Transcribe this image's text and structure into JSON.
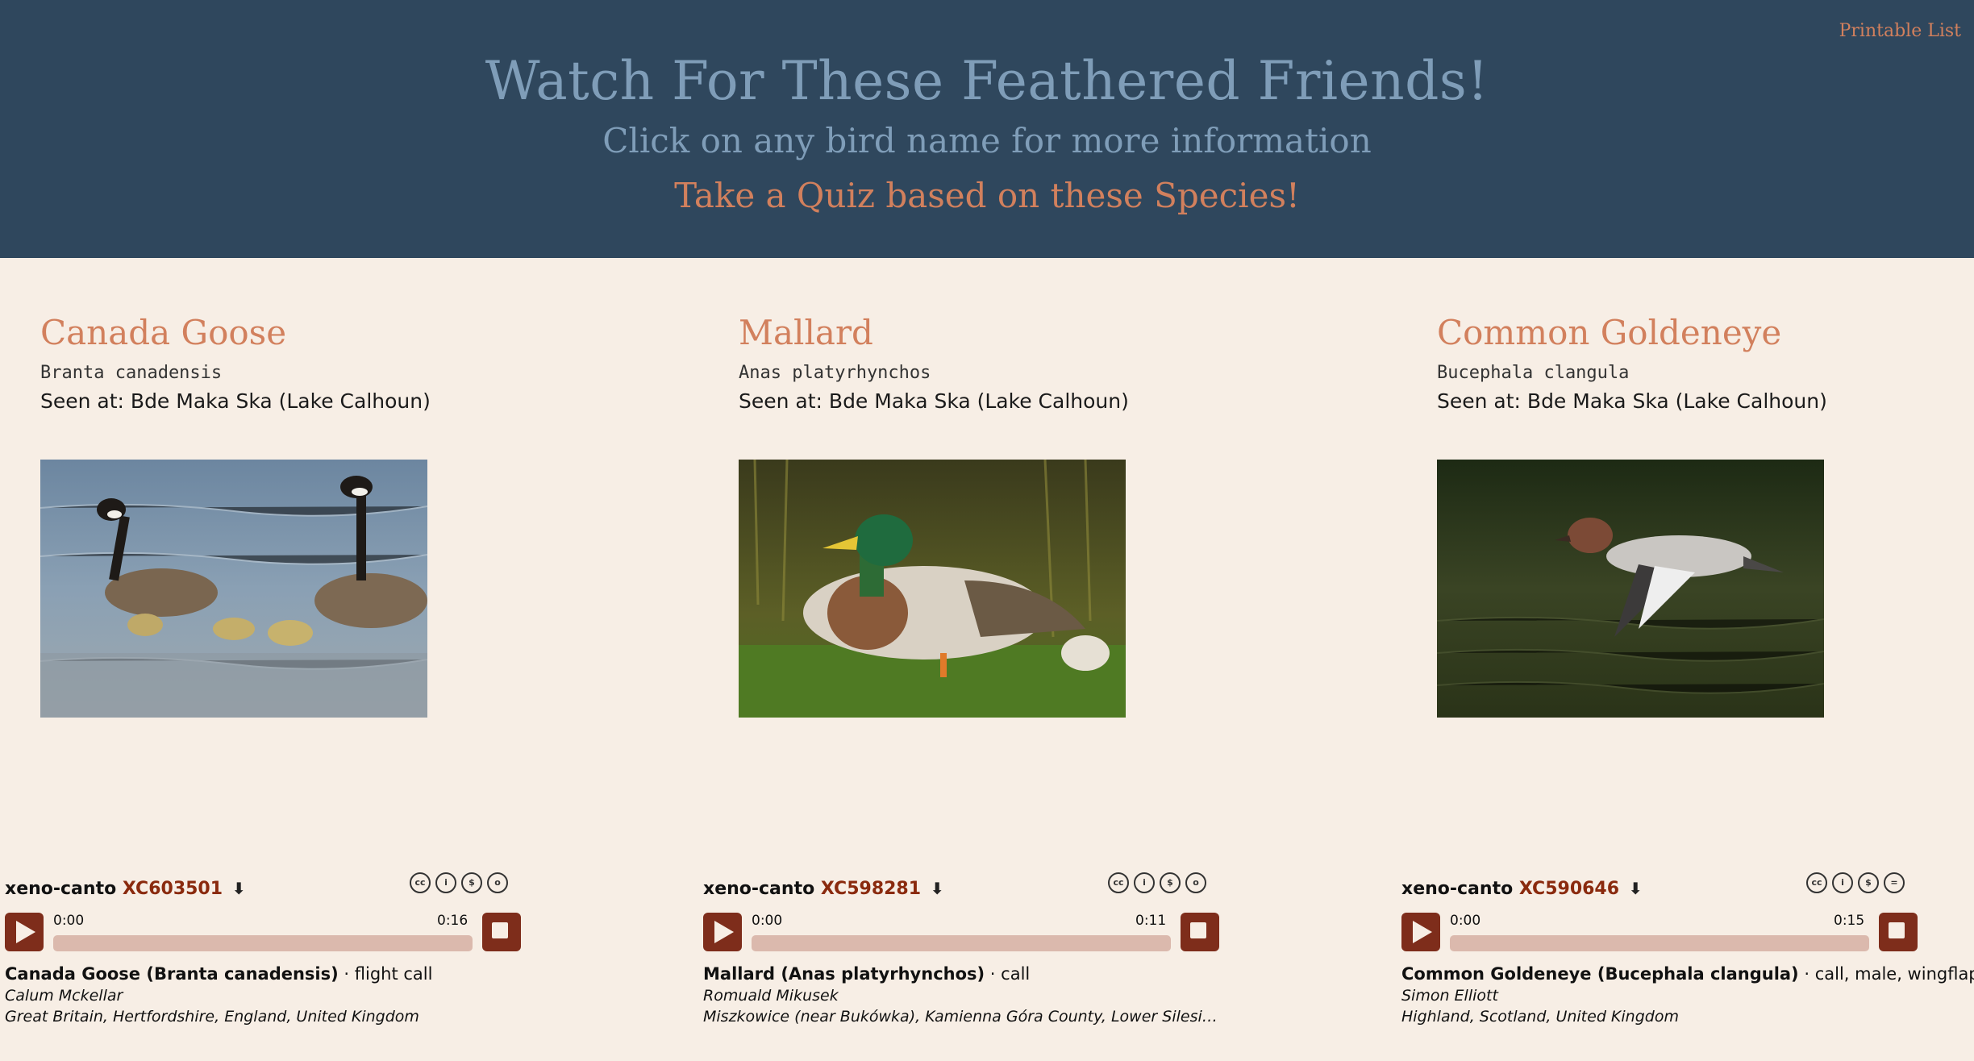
{
  "header": {
    "printable_link": "Printable List",
    "title": "Watch For These Feathered Friends!",
    "subtitle": "Click on any bird name for more information",
    "quiz_link": "Take a Quiz based on these Species!"
  },
  "birds": [
    {
      "name": "Canada Goose",
      "scientific": "Branta canadensis",
      "seen_at": "Seen at: Bde Maka Ska (Lake Calhoun)",
      "player": {
        "source": "xeno-canto",
        "xc_id": "XC603501",
        "time_start": "0:00",
        "time_end": "0:16",
        "progress": 0,
        "title_bold": "Canada Goose (Branta canadensis)",
        "title_rest": " · flight call",
        "recordist": "Calum Mckellar",
        "location": "Great Britain, Hertfordshire, England, United Kingdom"
      }
    },
    {
      "name": "Mallard",
      "scientific": "Anas platyrhynchos",
      "seen_at": "Seen at: Bde Maka Ska (Lake Calhoun)",
      "player": {
        "source": "xeno-canto",
        "xc_id": "XC598281",
        "time_start": "0:00",
        "time_end": "0:11",
        "progress": 0,
        "title_bold": "Mallard (Anas platyrhynchos)",
        "title_rest": " · call",
        "recordist": "Romuald Mikusek",
        "location": "Miszkowice (near Bukówka), Kamienna Góra County, Lower Silesian ..."
      }
    },
    {
      "name": "Common Goldeneye",
      "scientific": "Bucephala clangula",
      "seen_at": "Seen at: Bde Maka Ska (Lake Calhoun)",
      "player": {
        "source": "xeno-canto",
        "xc_id": "XC590646",
        "time_start": "0:00",
        "time_end": "0:15",
        "progress": 0,
        "title_bold": "Common Goldeneye (Bucephala clangula)",
        "title_rest": " · call, male, wingflap",
        "recordist": "Simon Elliott",
        "location": "Highland, Scotland, United Kingdom"
      }
    }
  ],
  "icons": {
    "play": "play-icon",
    "stop": "stop-icon",
    "download": "download-icon",
    "license": [
      "cc-icon",
      "by-icon",
      "nc-icon",
      "sa-icon"
    ]
  },
  "colors": {
    "header_bg": "#2f475d",
    "page_bg": "#f7eee5",
    "accent": "#d2805d",
    "title": "#7f9db8",
    "player_button": "#7e2d1b",
    "progress_track": "#dbb9ad"
  }
}
